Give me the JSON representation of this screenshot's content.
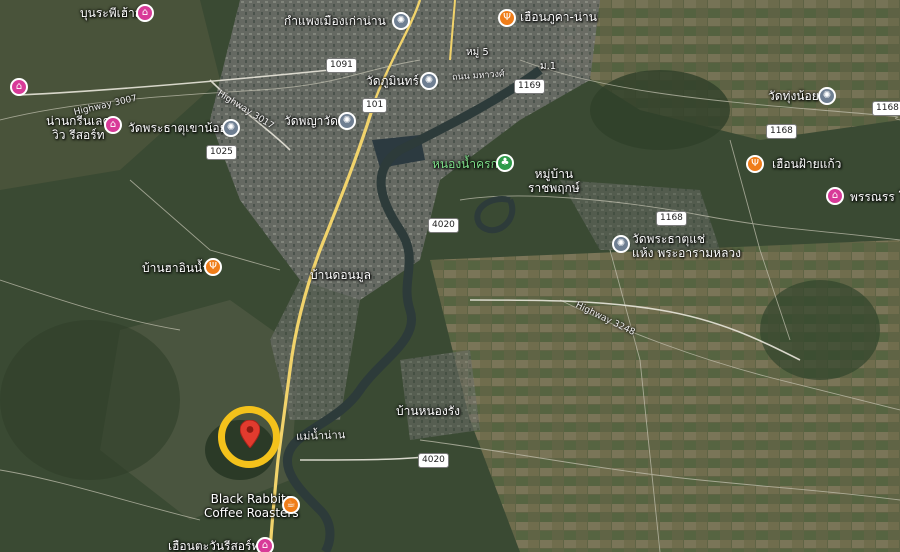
{
  "labels": {
    "bunsripheela": "บุนระพีเฮ้าส์",
    "kampaeng": "กำแพงเมืองเก่าน่าน",
    "huean_kha_nan": "เฮือนภูคา-น่าน",
    "moo5": "หมู่ 5",
    "thanon_nawaphong": "ถนน มหาวงศ์",
    "moo1": "ม.1",
    "wat_phumin": "วัดภูมินทร์",
    "wat_thung_noi": "วัดทุ่งน้อย",
    "nan_green_lake_1": "น่านกรีนเลค",
    "nan_green_lake_2": "วิว รีสอร์ท",
    "wat_phrathat_khao_noi": "วัดพระธาตุเขาน้อย",
    "wat_phaya_wat": "วัดพญาวัด",
    "nong_nam_khrok": "หนองน้ำครก",
    "moo_ban_1": "หมู่บ้าน",
    "moo_ban_2": "ราชพฤกษ์",
    "huean_fai_kaew": "เฮือนฝ้ายแก้ว",
    "phonrani": "พรรณรร โฮ",
    "wat_chae_1": "วัดพระธาตุแช่",
    "wat_chae_2": "แห้ง พระอารามหลวง",
    "ban_ha_in_nam": "บ้านฮาอินน้ำ",
    "ban_don_mun": "บ้านดอนมูล",
    "ban_nong_rang": "บ้านหนองรัง",
    "mae_nam_nan": "แม่น้ำน่าน",
    "black_rabbits_1": "Black Rabbits",
    "black_rabbits_2": "Coffee Roasters",
    "huean_tha_ruesot": "เฮือนตะวันรีสอร์ท"
  },
  "roads": {
    "highway_3007": "Highway 3007",
    "highway_3017": "Highway 3017",
    "highway_3248": "Highway 3248"
  },
  "shields": {
    "r1091": "1091",
    "r101": "101",
    "r1169": "1169",
    "r1168_a": "1168",
    "r1168_b": "1168",
    "r1168_c": "1168",
    "r1025": "1025",
    "r4020_a": "4020",
    "r4020_b": "4020"
  },
  "icons": {
    "restaurant": "fork-knife-icon",
    "hotel": "bed-icon",
    "temple": "dharma-wheel-icon",
    "park": "tree-icon",
    "cafe": "coffee-cup-icon",
    "pin": "location-pin-icon"
  },
  "colors": {
    "pin": "#e23b2e",
    "highlight_ring": "#f4c21b",
    "road_highway": "#f1d36b",
    "restaurant": "#ef7d1a",
    "hotel": "#d83a98"
  }
}
